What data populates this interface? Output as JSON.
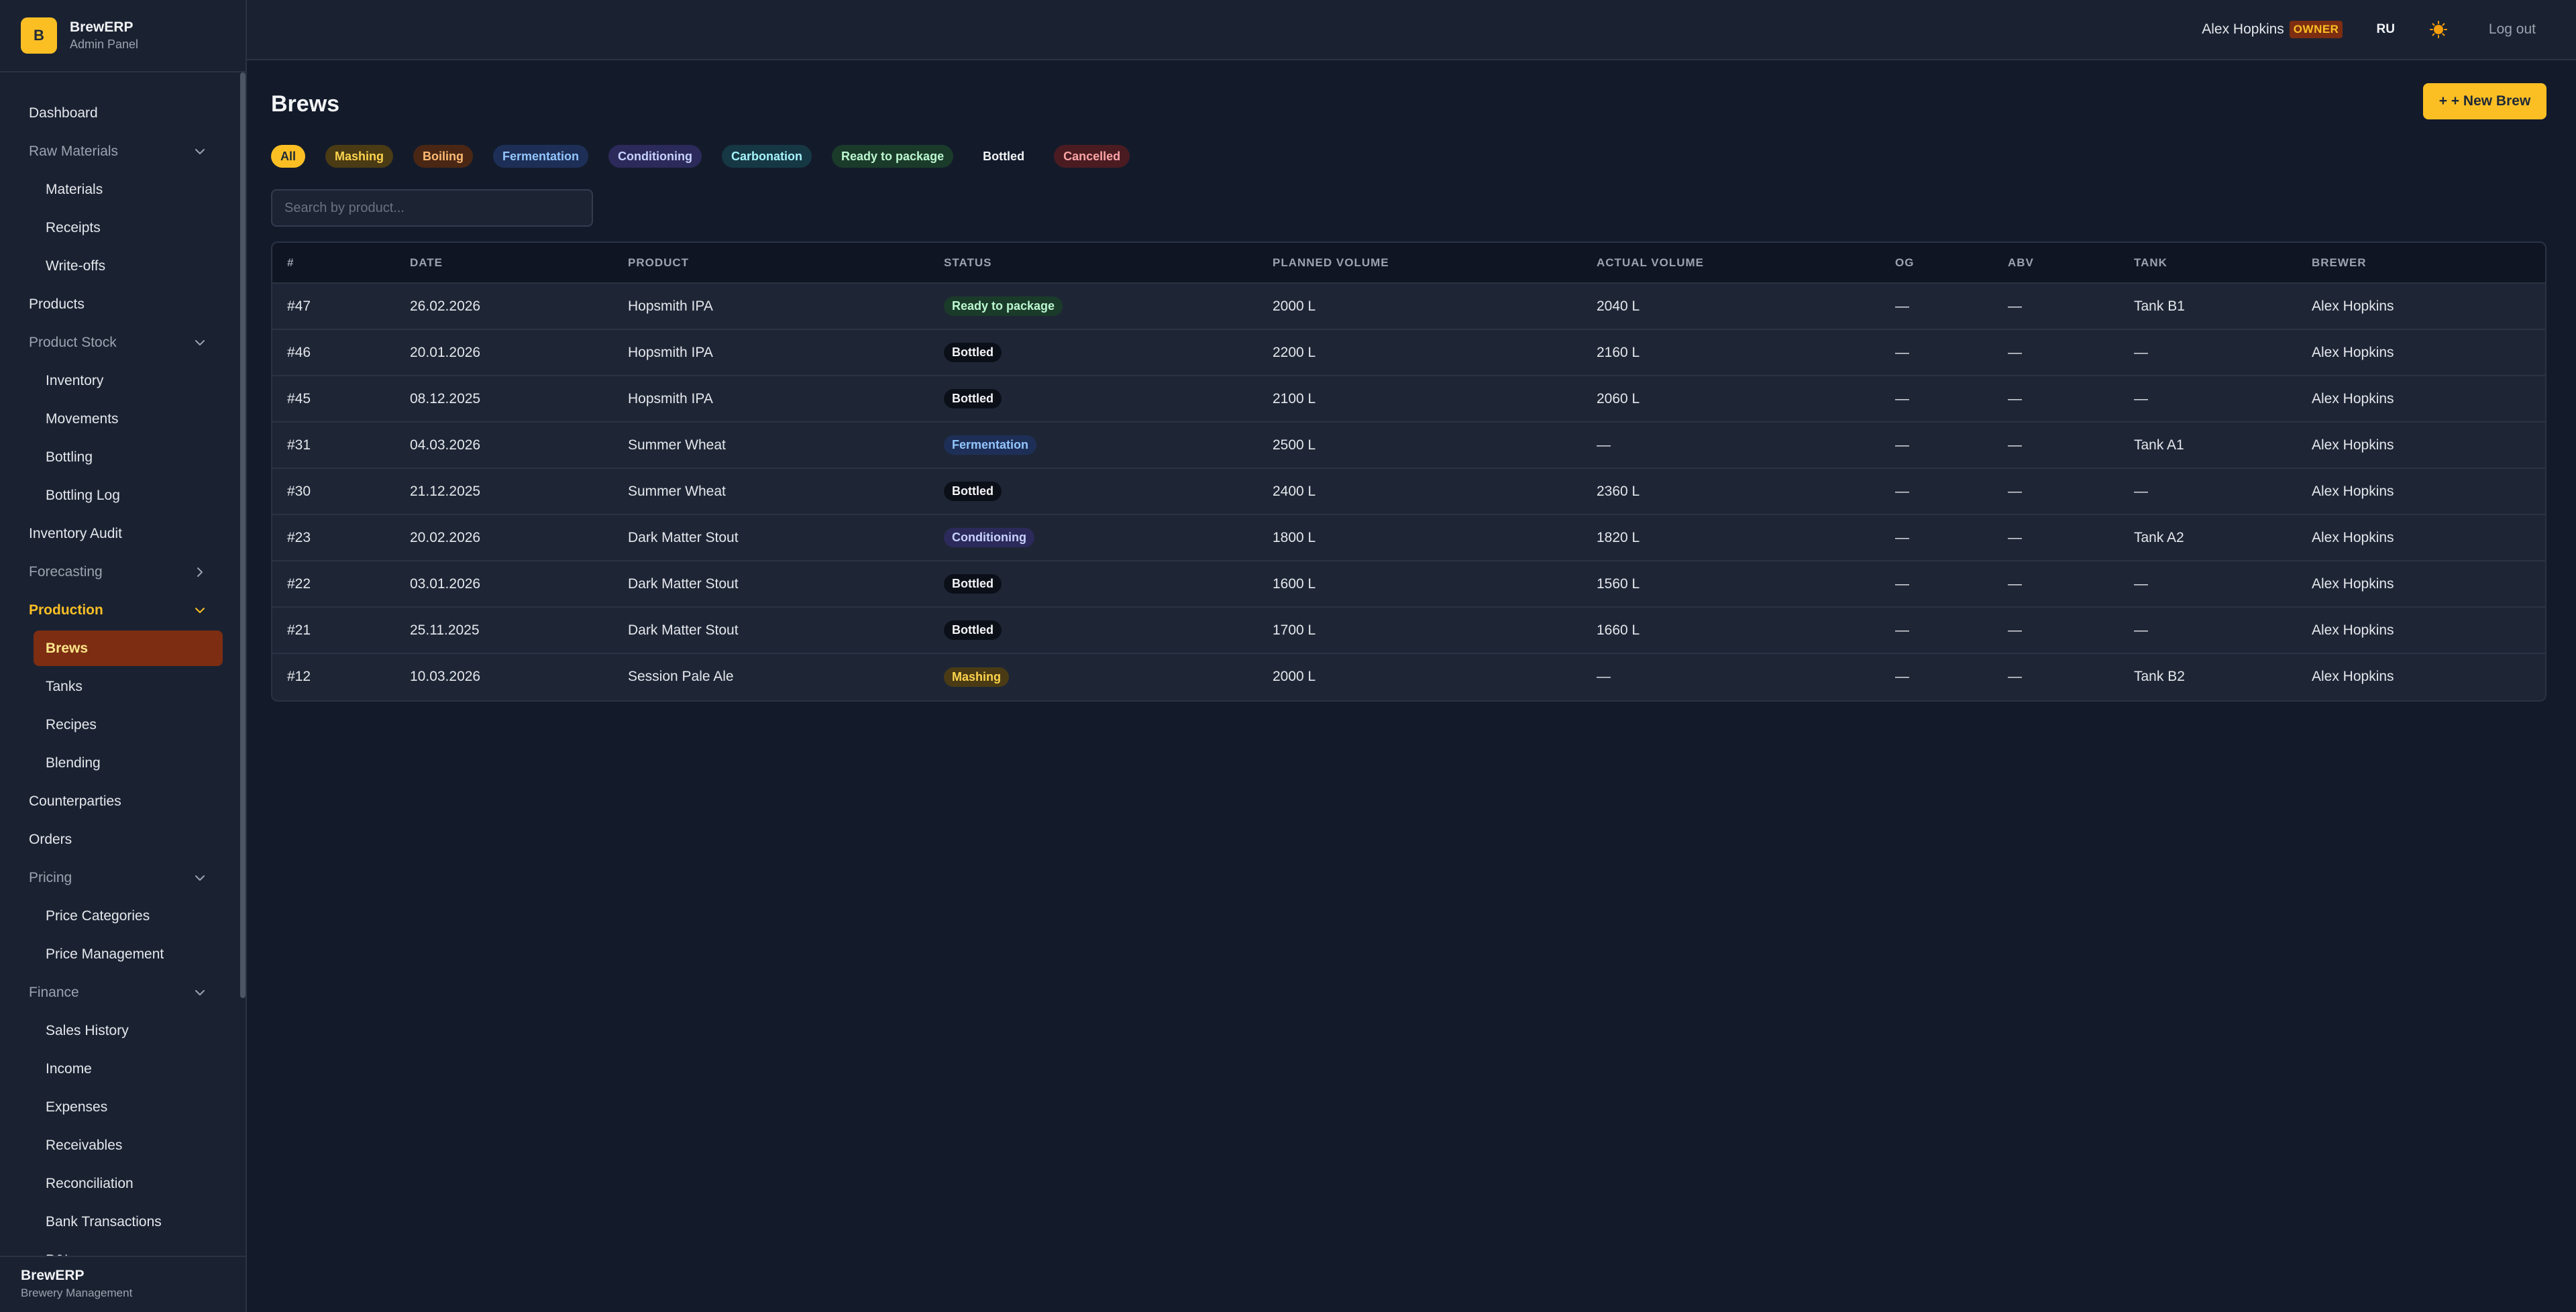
{
  "brand": {
    "logo_letter": "B",
    "name": "BrewERP",
    "subtitle": "Admin Panel"
  },
  "sidebar": {
    "items": [
      {
        "type": "item",
        "label": "Dashboard",
        "name": "sidebar-item-dashboard"
      },
      {
        "type": "group",
        "label": "Raw Materials",
        "name": "sidebar-group-raw-materials",
        "chevron": "down"
      },
      {
        "type": "sub",
        "label": "Materials",
        "name": "sidebar-item-materials"
      },
      {
        "type": "sub",
        "label": "Receipts",
        "name": "sidebar-item-receipts"
      },
      {
        "type": "sub",
        "label": "Write-offs",
        "name": "sidebar-item-write-offs"
      },
      {
        "type": "item",
        "label": "Products",
        "name": "sidebar-item-products"
      },
      {
        "type": "group",
        "label": "Product Stock",
        "name": "sidebar-group-product-stock",
        "chevron": "down"
      },
      {
        "type": "sub",
        "label": "Inventory",
        "name": "sidebar-item-inventory"
      },
      {
        "type": "sub",
        "label": "Movements",
        "name": "sidebar-item-movements"
      },
      {
        "type": "sub",
        "label": "Bottling",
        "name": "sidebar-item-bottling"
      },
      {
        "type": "sub",
        "label": "Bottling Log",
        "name": "sidebar-item-bottling-log"
      },
      {
        "type": "item",
        "label": "Inventory Audit",
        "name": "sidebar-item-inventory-audit"
      },
      {
        "type": "group",
        "label": "Forecasting",
        "name": "sidebar-group-forecasting",
        "chevron": "right"
      },
      {
        "type": "group",
        "label": "Production",
        "name": "sidebar-group-production",
        "chevron": "down",
        "active": true
      },
      {
        "type": "sub",
        "label": "Brews",
        "name": "sidebar-item-brews",
        "active": true
      },
      {
        "type": "sub",
        "label": "Tanks",
        "name": "sidebar-item-tanks"
      },
      {
        "type": "sub",
        "label": "Recipes",
        "name": "sidebar-item-recipes"
      },
      {
        "type": "sub",
        "label": "Blending",
        "name": "sidebar-item-blending"
      },
      {
        "type": "item",
        "label": "Counterparties",
        "name": "sidebar-item-counterparties"
      },
      {
        "type": "item",
        "label": "Orders",
        "name": "sidebar-item-orders"
      },
      {
        "type": "group",
        "label": "Pricing",
        "name": "sidebar-group-pricing",
        "chevron": "down"
      },
      {
        "type": "sub",
        "label": "Price Categories",
        "name": "sidebar-item-price-categories"
      },
      {
        "type": "sub",
        "label": "Price Management",
        "name": "sidebar-item-price-management"
      },
      {
        "type": "group",
        "label": "Finance",
        "name": "sidebar-group-finance",
        "chevron": "down"
      },
      {
        "type": "sub",
        "label": "Sales History",
        "name": "sidebar-item-sales-history"
      },
      {
        "type": "sub",
        "label": "Income",
        "name": "sidebar-item-income"
      },
      {
        "type": "sub",
        "label": "Expenses",
        "name": "sidebar-item-expenses"
      },
      {
        "type": "sub",
        "label": "Receivables",
        "name": "sidebar-item-receivables"
      },
      {
        "type": "sub",
        "label": "Reconciliation",
        "name": "sidebar-item-reconciliation"
      },
      {
        "type": "sub",
        "label": "Bank Transactions",
        "name": "sidebar-item-bank-transactions"
      },
      {
        "type": "sub",
        "label": "P&L",
        "name": "sidebar-item-pnl"
      }
    ],
    "footer": {
      "title": "BrewERP",
      "subtitle": "Brewery Management"
    }
  },
  "topbar": {
    "user_name": "Alex Hopkins",
    "role": "OWNER",
    "language": "RU",
    "theme_icon": "sun-icon",
    "logout_label": "Log out"
  },
  "page": {
    "title": "Brews",
    "new_button_label": "+ + New Brew",
    "search_placeholder": "Search by product..."
  },
  "filters": [
    {
      "label": "All",
      "bg": "#fbbf24",
      "fg": "#1f2937"
    },
    {
      "label": "Mashing",
      "bg": "#4a3b14",
      "fg": "#fcd34d"
    },
    {
      "label": "Boiling",
      "bg": "#4a2714",
      "fg": "#fdba74"
    },
    {
      "label": "Fermentation",
      "bg": "#1e2f57",
      "fg": "#93c5fd"
    },
    {
      "label": "Conditioning",
      "bg": "#2c2a5a",
      "fg": "#c7d2fe"
    },
    {
      "label": "Carbonation",
      "bg": "#163844",
      "fg": "#a5f3fc"
    },
    {
      "label": "Ready to package",
      "bg": "#1b3b2a",
      "fg": "#bbf7d0"
    },
    {
      "label": "Bottled",
      "bg": "transparent",
      "fg": "#f3f4f6"
    },
    {
      "label": "Cancelled",
      "bg": "#4a1c22",
      "fg": "#fca5a5"
    }
  ],
  "status_styles": {
    "Ready to package": {
      "bg": "#1b3b2a",
      "fg": "#bbf7d0"
    },
    "Bottled": {
      "bg": "#0b0f18",
      "fg": "#f3f4f6"
    },
    "Fermentation": {
      "bg": "#1e2f57",
      "fg": "#93c5fd"
    },
    "Conditioning": {
      "bg": "#2c2a5a",
      "fg": "#c7d2fe"
    },
    "Mashing": {
      "bg": "#4a3b14",
      "fg": "#fcd34d"
    }
  },
  "table": {
    "columns": [
      "#",
      "DATE",
      "PRODUCT",
      "STATUS",
      "PLANNED VOLUME",
      "ACTUAL VOLUME",
      "OG",
      "ABV",
      "TANK",
      "BREWER"
    ],
    "rows": [
      [
        "#47",
        "26.02.2026",
        "Hopsmith IPA",
        "Ready to package",
        "2000 L",
        "2040 L",
        "—",
        "—",
        "Tank B1",
        "Alex Hopkins"
      ],
      [
        "#46",
        "20.01.2026",
        "Hopsmith IPA",
        "Bottled",
        "2200 L",
        "2160 L",
        "—",
        "—",
        "—",
        "Alex Hopkins"
      ],
      [
        "#45",
        "08.12.2025",
        "Hopsmith IPA",
        "Bottled",
        "2100 L",
        "2060 L",
        "—",
        "—",
        "—",
        "Alex Hopkins"
      ],
      [
        "#31",
        "04.03.2026",
        "Summer Wheat",
        "Fermentation",
        "2500 L",
        "—",
        "—",
        "—",
        "Tank A1",
        "Alex Hopkins"
      ],
      [
        "#30",
        "21.12.2025",
        "Summer Wheat",
        "Bottled",
        "2400 L",
        "2360 L",
        "—",
        "—",
        "—",
        "Alex Hopkins"
      ],
      [
        "#23",
        "20.02.2026",
        "Dark Matter Stout",
        "Conditioning",
        "1800 L",
        "1820 L",
        "—",
        "—",
        "Tank A2",
        "Alex Hopkins"
      ],
      [
        "#22",
        "03.01.2026",
        "Dark Matter Stout",
        "Bottled",
        "1600 L",
        "1560 L",
        "—",
        "—",
        "—",
        "Alex Hopkins"
      ],
      [
        "#21",
        "25.11.2025",
        "Dark Matter Stout",
        "Bottled",
        "1700 L",
        "1660 L",
        "—",
        "—",
        "—",
        "Alex Hopkins"
      ],
      [
        "#12",
        "10.03.2026",
        "Session Pale Ale",
        "Mashing",
        "2000 L",
        "—",
        "—",
        "—",
        "Tank B2",
        "Alex Hopkins"
      ]
    ]
  }
}
